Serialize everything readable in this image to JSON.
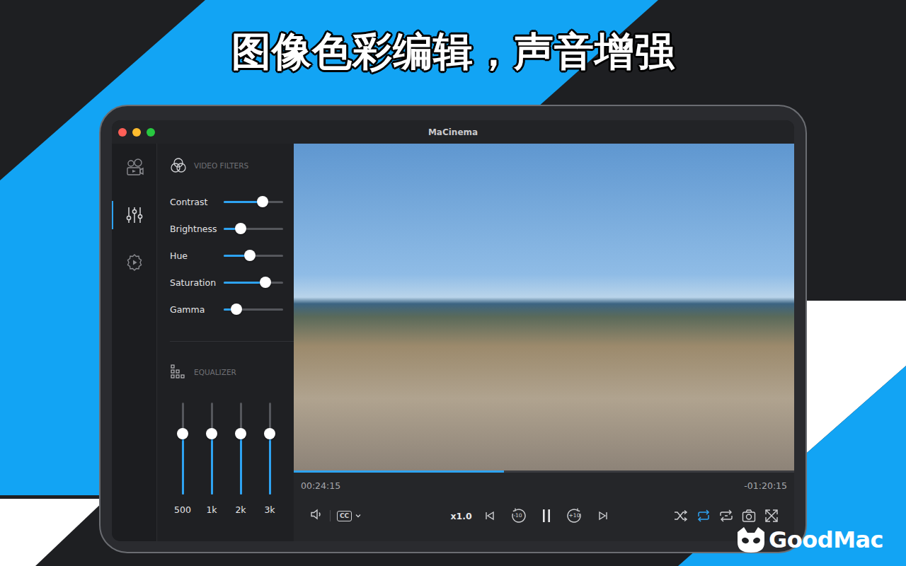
{
  "window": {
    "title": "MaCinema"
  },
  "headline": "图像色彩编辑，声音增强",
  "sidebar": {
    "items": [
      {
        "selected": false
      },
      {
        "selected": true
      },
      {
        "selected": false
      }
    ]
  },
  "filters": {
    "title": "VIDEO FILTERS",
    "sliders": [
      {
        "label": "Contrast",
        "level": 0.65
      },
      {
        "label": "Brightness",
        "level": 0.29
      },
      {
        "label": "Hue",
        "level": 0.44
      },
      {
        "label": "Saturation",
        "level": 0.7
      },
      {
        "label": "Gamma",
        "level": 0.21
      }
    ]
  },
  "equalizer": {
    "title": "EQUALIZER",
    "bands": [
      {
        "label": "500",
        "level": 0.66
      },
      {
        "label": "1k",
        "level": 0.66
      },
      {
        "label": "2k",
        "level": 0.66
      },
      {
        "label": "3k",
        "level": 0.66
      }
    ]
  },
  "player": {
    "elapsed": "00:24:15",
    "remaining": "-01:20:15",
    "progress": {
      "level": 0.42
    },
    "caption": "CC",
    "speed": "x1.0",
    "rewind": "-10",
    "forward": "+10",
    "playing": true,
    "shuffle": {
      "on": false
    },
    "repeat": {
      "on": true
    },
    "loop": {
      "on": false
    }
  },
  "brand": {
    "name": "GoodMac"
  }
}
